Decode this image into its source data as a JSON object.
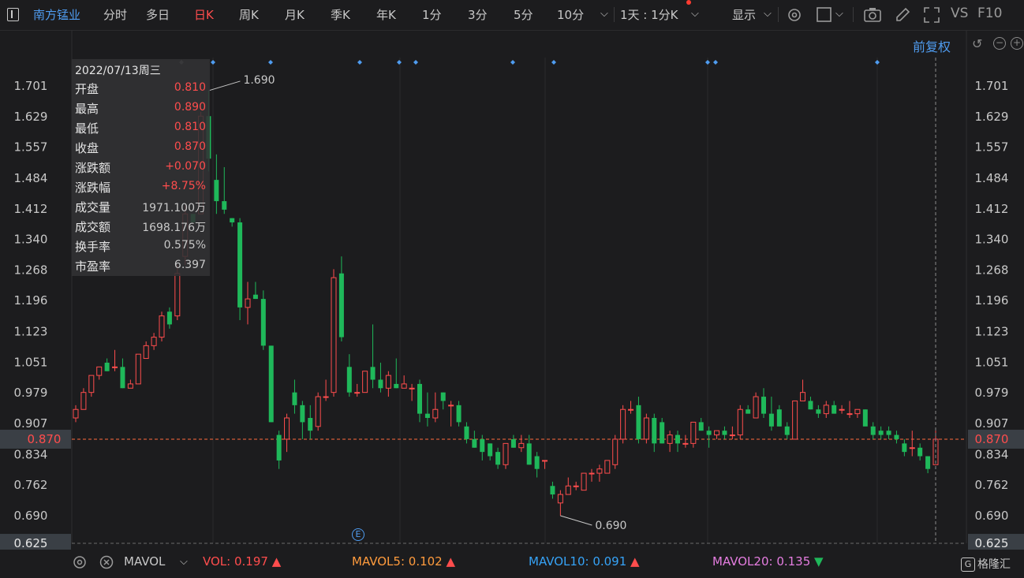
{
  "toolbar": {
    "stock_name": "南方锰业",
    "periods": [
      "分时",
      "多日",
      "日K",
      "周K",
      "月K",
      "季K",
      "年K",
      "1分",
      "3分",
      "5分",
      "10分"
    ],
    "active_period": "日K",
    "multi_period": "1天 : 1分K",
    "display": "显示",
    "compare_label": "VS",
    "f10_label": "F10",
    "icons": [
      "gear-icon",
      "square-icon",
      "camera-icon",
      "pencil-icon",
      "fullscreen-icon"
    ]
  },
  "adjust": {
    "label": "前复权"
  },
  "info": {
    "date": "2022/07/13周三",
    "rows": [
      {
        "label": "开盘",
        "value": "0.810",
        "color": "red"
      },
      {
        "label": "最高",
        "value": "0.890",
        "color": "red"
      },
      {
        "label": "最低",
        "value": "0.810",
        "color": "red"
      },
      {
        "label": "收盘",
        "value": "0.870",
        "color": "red"
      },
      {
        "label": "涨跌额",
        "value": "+0.070",
        "color": "red"
      },
      {
        "label": "涨跌幅",
        "value": "+8.75%",
        "color": "red"
      },
      {
        "label": "成交量",
        "value": "1971.100万",
        "color": "gray"
      },
      {
        "label": "成交额",
        "value": "1698.176万",
        "color": "gray"
      },
      {
        "label": "换手率",
        "value": "0.575%",
        "color": "gray"
      },
      {
        "label": "市盈率",
        "value": "6.397",
        "color": "gray"
      }
    ]
  },
  "bottom": {
    "indicator": "MAVOL",
    "vol": "VOL: 0.197",
    "mavol5": "MAVOL5: 0.102",
    "mavol10": "MAVOL10: 0.091",
    "mavol20": "MAVOL20: 0.135",
    "logo": "格隆汇",
    "logo_mark": "G"
  },
  "colors": {
    "up": "#ff4d4d",
    "down": "#1fb85a",
    "accent": "#4f9cf0",
    "vol": "#ff4d4d",
    "mavol5": "#ff9b3d",
    "mavol10": "#36a3f7",
    "mavol20": "#e57de0"
  },
  "chart_data": {
    "type": "candlestick",
    "y_ticks": [
      "1.701",
      "1.629",
      "1.557",
      "1.484",
      "1.412",
      "1.340",
      "1.268",
      "1.196",
      "1.123",
      "1.051",
      "0.979",
      "0.907",
      "0.834",
      "0.762",
      "0.690"
    ],
    "ylim": [
      0.625,
      1.701
    ],
    "current_price": "0.870",
    "bottom_price": "0.625",
    "annotations": [
      {
        "text": "1.690",
        "value": 1.69
      },
      {
        "text": "0.690",
        "value": 0.69
      }
    ],
    "event_marker": "E",
    "candles": [
      {
        "o": 0.92,
        "h": 0.95,
        "l": 0.91,
        "c": 0.94
      },
      {
        "o": 0.94,
        "h": 0.99,
        "l": 0.94,
        "c": 0.98
      },
      {
        "o": 0.98,
        "h": 1.02,
        "l": 0.97,
        "c": 1.02
      },
      {
        "o": 1.02,
        "h": 1.04,
        "l": 1.01,
        "c": 1.04
      },
      {
        "o": 1.05,
        "h": 1.06,
        "l": 1.03,
        "c": 1.03
      },
      {
        "o": 1.04,
        "h": 1.08,
        "l": 1.03,
        "c": 1.04
      },
      {
        "o": 1.04,
        "h": 1.06,
        "l": 0.99,
        "c": 0.99
      },
      {
        "o": 0.99,
        "h": 1.01,
        "l": 0.99,
        "c": 1.0
      },
      {
        "o": 1.0,
        "h": 1.07,
        "l": 1.0,
        "c": 1.07
      },
      {
        "o": 1.06,
        "h": 1.1,
        "l": 1.06,
        "c": 1.09
      },
      {
        "o": 1.09,
        "h": 1.12,
        "l": 1.08,
        "c": 1.11
      },
      {
        "o": 1.11,
        "h": 1.17,
        "l": 1.1,
        "c": 1.16
      },
      {
        "o": 1.17,
        "h": 1.18,
        "l": 1.13,
        "c": 1.14
      },
      {
        "o": 1.16,
        "h": 1.28,
        "l": 1.15,
        "c": 1.26
      },
      {
        "o": 1.3,
        "h": 1.42,
        "l": 1.28,
        "c": 1.4
      },
      {
        "o": 1.4,
        "h": 1.38,
        "l": 1.38,
        "c": 1.38
      },
      {
        "o": 1.4,
        "h": 1.64,
        "l": 1.4,
        "c": 1.63
      },
      {
        "o": 1.63,
        "h": 1.69,
        "l": 1.5,
        "c": 1.53
      },
      {
        "o": 1.48,
        "h": 1.54,
        "l": 1.4,
        "c": 1.43
      },
      {
        "o": 1.43,
        "h": 1.51,
        "l": 1.4,
        "c": 1.41
      },
      {
        "o": 1.39,
        "h": 1.39,
        "l": 1.37,
        "c": 1.38
      },
      {
        "o": 1.38,
        "h": 1.39,
        "l": 1.15,
        "c": 1.18
      },
      {
        "o": 1.18,
        "h": 1.24,
        "l": 1.14,
        "c": 1.2
      },
      {
        "o": 1.21,
        "h": 1.24,
        "l": 1.2,
        "c": 1.2
      },
      {
        "o": 1.2,
        "h": 1.22,
        "l": 1.08,
        "c": 1.09
      },
      {
        "o": 1.09,
        "h": 1.09,
        "l": 0.91,
        "c": 0.91
      },
      {
        "o": 0.88,
        "h": 0.89,
        "l": 0.8,
        "c": 0.82
      },
      {
        "o": 0.87,
        "h": 0.93,
        "l": 0.84,
        "c": 0.92
      },
      {
        "o": 0.98,
        "h": 1.01,
        "l": 0.93,
        "c": 0.95
      },
      {
        "o": 0.95,
        "h": 0.96,
        "l": 0.87,
        "c": 0.91
      },
      {
        "o": 0.92,
        "h": 0.95,
        "l": 0.87,
        "c": 0.89
      },
      {
        "o": 0.9,
        "h": 0.98,
        "l": 0.89,
        "c": 0.97
      },
      {
        "o": 0.97,
        "h": 1.01,
        "l": 0.96,
        "c": 0.97
      },
      {
        "o": 0.98,
        "h": 1.27,
        "l": 0.97,
        "c": 1.25
      },
      {
        "o": 1.26,
        "h": 1.3,
        "l": 1.1,
        "c": 1.11
      },
      {
        "o": 1.04,
        "h": 1.07,
        "l": 0.97,
        "c": 0.98
      },
      {
        "o": 0.98,
        "h": 1.0,
        "l": 0.97,
        "c": 0.98
      },
      {
        "o": 0.98,
        "h": 1.02,
        "l": 0.98,
        "c": 1.03
      },
      {
        "o": 1.04,
        "h": 1.14,
        "l": 0.99,
        "c": 1.01
      },
      {
        "o": 1.01,
        "h": 1.05,
        "l": 0.98,
        "c": 0.99
      },
      {
        "o": 0.99,
        "h": 1.03,
        "l": 0.97,
        "c": 1.02
      },
      {
        "o": 1.0,
        "h": 1.06,
        "l": 0.99,
        "c": 0.99
      },
      {
        "o": 0.99,
        "h": 1.02,
        "l": 0.99,
        "c": 1.0
      },
      {
        "o": 0.99,
        "h": 1.0,
        "l": 0.96,
        "c": 0.99
      },
      {
        "o": 1.0,
        "h": 1.01,
        "l": 0.91,
        "c": 0.93
      },
      {
        "o": 0.93,
        "h": 0.98,
        "l": 0.9,
        "c": 0.92
      },
      {
        "o": 0.92,
        "h": 0.98,
        "l": 0.91,
        "c": 0.94
      },
      {
        "o": 0.98,
        "h": 0.98,
        "l": 0.94,
        "c": 0.96
      },
      {
        "o": 0.95,
        "h": 0.96,
        "l": 0.9,
        "c": 0.95
      },
      {
        "o": 0.95,
        "h": 0.96,
        "l": 0.9,
        "c": 0.91
      },
      {
        "o": 0.9,
        "h": 0.91,
        "l": 0.86,
        "c": 0.87
      },
      {
        "o": 0.87,
        "h": 0.89,
        "l": 0.85,
        "c": 0.85
      },
      {
        "o": 0.87,
        "h": 0.88,
        "l": 0.82,
        "c": 0.84
      },
      {
        "o": 0.86,
        "h": 0.86,
        "l": 0.82,
        "c": 0.83
      },
      {
        "o": 0.84,
        "h": 0.85,
        "l": 0.8,
        "c": 0.81
      },
      {
        "o": 0.81,
        "h": 0.86,
        "l": 0.8,
        "c": 0.86
      },
      {
        "o": 0.87,
        "h": 0.88,
        "l": 0.85,
        "c": 0.85
      },
      {
        "o": 0.85,
        "h": 0.88,
        "l": 0.84,
        "c": 0.86
      },
      {
        "o": 0.86,
        "h": 0.88,
        "l": 0.81,
        "c": 0.81
      },
      {
        "o": 0.83,
        "h": 0.84,
        "l": 0.78,
        "c": 0.8
      },
      {
        "o": 0.82,
        "h": 0.82,
        "l": 0.8,
        "c": 0.82
      },
      {
        "o": 0.76,
        "h": 0.77,
        "l": 0.73,
        "c": 0.74
      },
      {
        "o": 0.72,
        "h": 0.75,
        "l": 0.69,
        "c": 0.74
      },
      {
        "o": 0.74,
        "h": 0.78,
        "l": 0.74,
        "c": 0.76
      },
      {
        "o": 0.76,
        "h": 0.77,
        "l": 0.75,
        "c": 0.76
      },
      {
        "o": 0.75,
        "h": 0.79,
        "l": 0.75,
        "c": 0.79
      },
      {
        "o": 0.79,
        "h": 0.8,
        "l": 0.77,
        "c": 0.79
      },
      {
        "o": 0.79,
        "h": 0.81,
        "l": 0.77,
        "c": 0.8
      },
      {
        "o": 0.79,
        "h": 0.82,
        "l": 0.79,
        "c": 0.82
      },
      {
        "o": 0.81,
        "h": 0.88,
        "l": 0.8,
        "c": 0.87
      },
      {
        "o": 0.87,
        "h": 0.95,
        "l": 0.86,
        "c": 0.94
      },
      {
        "o": 0.94,
        "h": 0.96,
        "l": 0.93,
        "c": 0.94
      },
      {
        "o": 0.95,
        "h": 0.97,
        "l": 0.86,
        "c": 0.87
      },
      {
        "o": 0.87,
        "h": 0.93,
        "l": 0.86,
        "c": 0.92
      },
      {
        "o": 0.92,
        "h": 0.93,
        "l": 0.84,
        "c": 0.86
      },
      {
        "o": 0.91,
        "h": 0.92,
        "l": 0.86,
        "c": 0.86
      },
      {
        "o": 0.86,
        "h": 0.89,
        "l": 0.84,
        "c": 0.88
      },
      {
        "o": 0.88,
        "h": 0.89,
        "l": 0.84,
        "c": 0.86
      },
      {
        "o": 0.86,
        "h": 0.88,
        "l": 0.85,
        "c": 0.86
      },
      {
        "o": 0.86,
        "h": 0.91,
        "l": 0.85,
        "c": 0.91
      },
      {
        "o": 0.91,
        "h": 0.92,
        "l": 0.89,
        "c": 0.89
      },
      {
        "o": 0.89,
        "h": 0.9,
        "l": 0.85,
        "c": 0.88
      },
      {
        "o": 0.88,
        "h": 0.89,
        "l": 0.87,
        "c": 0.89
      },
      {
        "o": 0.89,
        "h": 0.9,
        "l": 0.87,
        "c": 0.88
      },
      {
        "o": 0.88,
        "h": 0.9,
        "l": 0.87,
        "c": 0.88
      },
      {
        "o": 0.88,
        "h": 0.95,
        "l": 0.87,
        "c": 0.94
      },
      {
        "o": 0.94,
        "h": 0.95,
        "l": 0.93,
        "c": 0.93
      },
      {
        "o": 0.92,
        "h": 0.98,
        "l": 0.92,
        "c": 0.97
      },
      {
        "o": 0.97,
        "h": 0.99,
        "l": 0.92,
        "c": 0.93
      },
      {
        "o": 0.93,
        "h": 0.97,
        "l": 0.89,
        "c": 0.9
      },
      {
        "o": 0.94,
        "h": 0.95,
        "l": 0.9,
        "c": 0.9
      },
      {
        "o": 0.9,
        "h": 0.91,
        "l": 0.87,
        "c": 0.88
      },
      {
        "o": 0.87,
        "h": 0.96,
        "l": 0.87,
        "c": 0.96
      },
      {
        "o": 0.96,
        "h": 1.01,
        "l": 0.96,
        "c": 0.98
      },
      {
        "o": 0.96,
        "h": 0.97,
        "l": 0.94,
        "c": 0.94
      },
      {
        "o": 0.94,
        "h": 0.95,
        "l": 0.92,
        "c": 0.93
      },
      {
        "o": 0.93,
        "h": 0.96,
        "l": 0.92,
        "c": 0.95
      },
      {
        "o": 0.95,
        "h": 0.96,
        "l": 0.93,
        "c": 0.93
      },
      {
        "o": 0.94,
        "h": 0.95,
        "l": 0.93,
        "c": 0.94
      },
      {
        "o": 0.93,
        "h": 0.96,
        "l": 0.92,
        "c": 0.93
      },
      {
        "o": 0.93,
        "h": 0.94,
        "l": 0.92,
        "c": 0.94
      },
      {
        "o": 0.94,
        "h": 0.94,
        "l": 0.91,
        "c": 0.9
      },
      {
        "o": 0.9,
        "h": 0.91,
        "l": 0.87,
        "c": 0.88
      },
      {
        "o": 0.89,
        "h": 0.9,
        "l": 0.87,
        "c": 0.88
      },
      {
        "o": 0.89,
        "h": 0.9,
        "l": 0.87,
        "c": 0.88
      },
      {
        "o": 0.88,
        "h": 0.89,
        "l": 0.86,
        "c": 0.87
      },
      {
        "o": 0.86,
        "h": 0.87,
        "l": 0.83,
        "c": 0.84
      },
      {
        "o": 0.85,
        "h": 0.89,
        "l": 0.83,
        "c": 0.85
      },
      {
        "o": 0.85,
        "h": 0.86,
        "l": 0.82,
        "c": 0.83
      },
      {
        "o": 0.83,
        "h": 0.83,
        "l": 0.79,
        "c": 0.8
      },
      {
        "o": 0.81,
        "h": 0.89,
        "l": 0.81,
        "c": 0.87
      }
    ]
  }
}
